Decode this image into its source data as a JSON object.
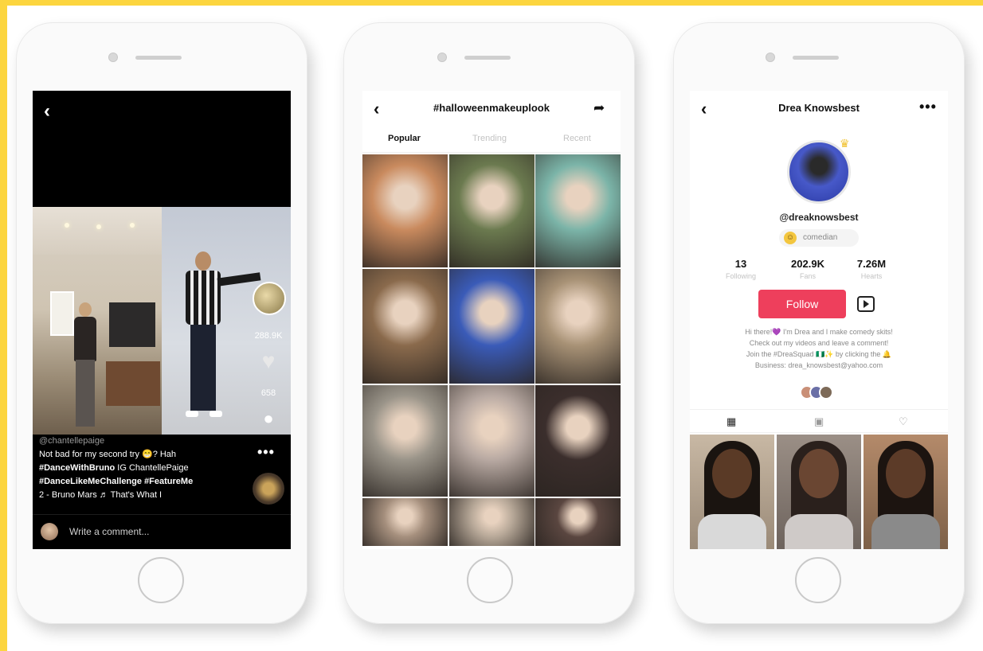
{
  "frame": {
    "border_color": "#fcd53f"
  },
  "video_screen": {
    "views_count": "288.9K",
    "comments_count": "658",
    "handle": "@chantellepaige",
    "caption_line1": "Not bad for my second try 😁? Hah",
    "caption_tag1": "#DanceWithBruno",
    "caption_tag1_suffix": " IG ChantellePaige",
    "caption_tags2": "#DanceLikeMeChallenge  #FeatureMe",
    "music": "2 - Bruno Mars  ♬ That's What I",
    "comment_placeholder": "Write a comment..."
  },
  "hashtag_screen": {
    "title": "#halloweenmakeuplook",
    "tabs": [
      {
        "label": "Popular",
        "active": true
      },
      {
        "label": "Trending",
        "active": false
      },
      {
        "label": "Recent",
        "active": false
      }
    ],
    "tile_colors": [
      [
        "#c98a5e",
        "#6b7a4f",
        "#7bb4a8"
      ],
      [
        "#8a6a4c",
        "#3a5bb8",
        "#a89276"
      ],
      [
        "#9a9489",
        "#b8a9a2",
        "#3b2e2c"
      ],
      [
        "#a58f7d",
        "#b7a898",
        "#5a4640"
      ]
    ]
  },
  "profile_screen": {
    "name": "Drea Knowsbest",
    "handle": "@dreaknowsbest",
    "badge": "comedian",
    "badge_emoji": "😁",
    "stats": [
      {
        "value": "13",
        "label": "Following"
      },
      {
        "value": "202.9K",
        "label": "Fans"
      },
      {
        "value": "7.26M",
        "label": "Hearts"
      }
    ],
    "follow_label": "Follow",
    "accent_color": "#ee3f5c",
    "bio": [
      "Hi there!💜 I'm Drea and I make comedy skits!",
      "Check out my videos and leave a comment!",
      "Join the #DreaSquad 🇳🇬✨ by clicking the 🔔",
      "Business: drea_knowsbest@yahoo.com"
    ]
  }
}
